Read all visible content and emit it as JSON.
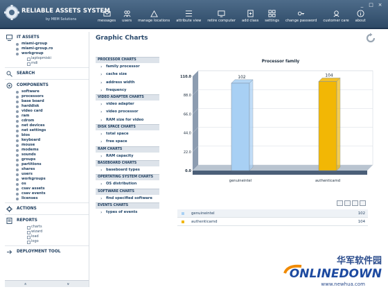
{
  "app": {
    "title": "RELIABLE ASSETS SYSTEM",
    "subtitle": "by MBM Solutions"
  },
  "topnav": [
    {
      "label": "messages",
      "icon": "messages-icon"
    },
    {
      "label": "users",
      "icon": "users-icon"
    },
    {
      "label": "manage locations",
      "icon": "locations-icon"
    },
    {
      "label": "attribute view",
      "icon": "attribute-icon"
    },
    {
      "label": "retire computer",
      "icon": "retire-icon"
    },
    {
      "label": "add class",
      "icon": "add-class-icon"
    },
    {
      "label": "settings",
      "icon": "settings-icon"
    },
    {
      "label": "change password",
      "icon": "key-icon"
    },
    {
      "label": "customer care",
      "icon": "customer-care-icon"
    },
    {
      "label": "about",
      "icon": "about-icon"
    }
  ],
  "sidebar": {
    "it_assets": {
      "label": "IT ASSETS",
      "items": [
        "miami-group",
        "miami-group.ro",
        "workgroup"
      ],
      "subitems": [
        "laptopmiski",
        "mdi"
      ]
    },
    "search": {
      "label": "SEARCH"
    },
    "components": {
      "label": "COMPONENTS",
      "items": [
        "software",
        "processors",
        "base board",
        "harddisk",
        "video card",
        "ram",
        "cdrom",
        "net devices",
        "net settings",
        "bios",
        "keyboard",
        "mouse",
        "modems",
        "sounds",
        "groups",
        "partitions",
        "shares",
        "users",
        "workgroups",
        "os",
        "csav assets",
        "csav events",
        "licenses"
      ]
    },
    "actions": {
      "label": "ACTIONS"
    },
    "reports": {
      "label": "REPORTS",
      "items": [
        "charts",
        "wizard",
        "load",
        "logo"
      ]
    },
    "deployment": {
      "label": "DEPLOYMENT TOOL"
    },
    "footer": {
      "up": "»",
      "down": "»"
    }
  },
  "page": {
    "title": "Graphic Charts"
  },
  "chart_categories": [
    {
      "header": "PROCESSOR CHARTS",
      "items": [
        "family processor",
        "cache size",
        "address width",
        "frequency"
      ]
    },
    {
      "header": "VIDEO ADAPTER CHARTS",
      "items": [
        "video adapter",
        "video processor",
        "RAM size for video"
      ]
    },
    {
      "header": "DISK SPACE CHARTS",
      "items": [
        "total space",
        "free space"
      ]
    },
    {
      "header": "RAM CHARTS",
      "items": [
        "RAM capacity"
      ]
    },
    {
      "header": "BASEBOARD CHARTS",
      "items": [
        "baseboard types"
      ]
    },
    {
      "header": "OPERTATING SYSTEM CHARTS",
      "items": [
        "OS distribution"
      ]
    },
    {
      "header": "SOFTWARE CHARTS",
      "items": [
        "find specified software"
      ]
    },
    {
      "header": "EVENTS CHARTS",
      "items": [
        "types of events"
      ]
    }
  ],
  "chart_data": {
    "type": "bar",
    "title": "Processor family",
    "categories": [
      "genuineintel",
      "authenticamd"
    ],
    "values": [
      102,
      104
    ],
    "colors": [
      "#a8d0f4",
      "#f2b705"
    ],
    "ylim": [
      0,
      110
    ],
    "yticks": [
      "0.0",
      "22.0",
      "44.0",
      "66.0",
      "88.0",
      "110.0"
    ],
    "grid": true,
    "legend": "bottom"
  },
  "legend_rows": [
    {
      "name": "genuineintel",
      "value": "102",
      "color": "#a8d0f4"
    },
    {
      "name": "authenticamd",
      "value": "104",
      "color": "#f2b705"
    }
  ],
  "watermark": {
    "line1": "华军软件园",
    "line2": "ONLINEDOWN",
    "line3": "www.newhua.com"
  }
}
